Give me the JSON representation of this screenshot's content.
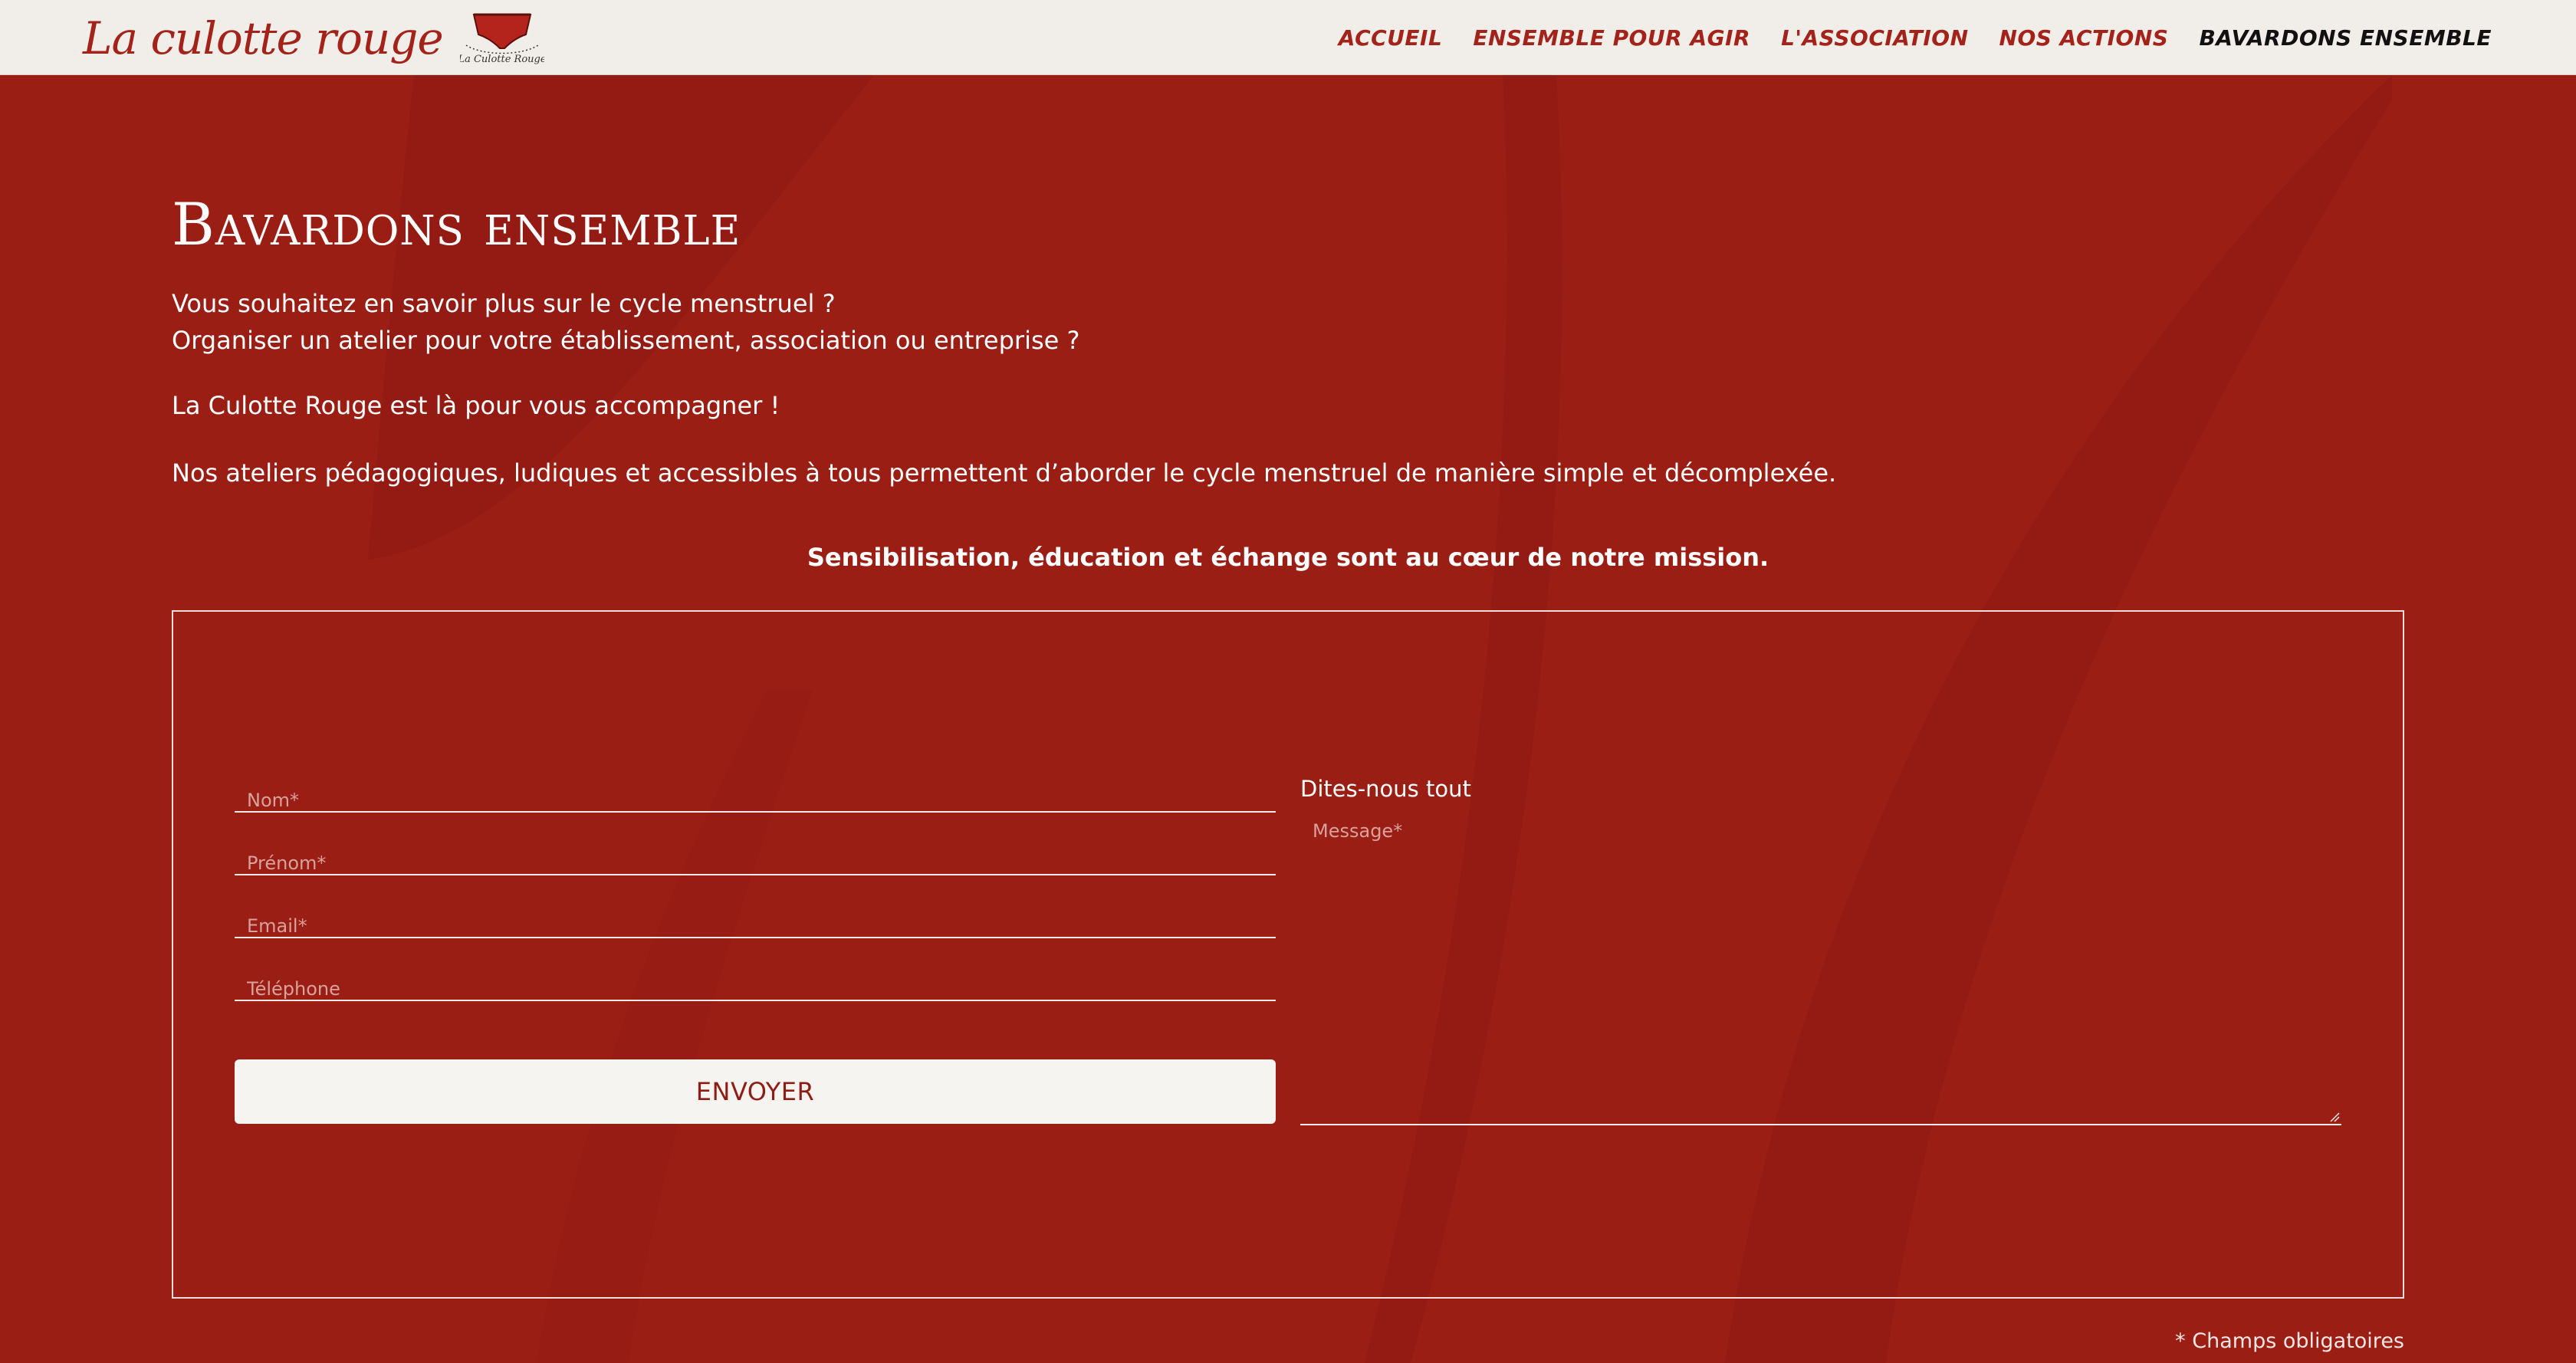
{
  "colors": {
    "background": "#9b1e15",
    "header_bg": "#f1eee9",
    "brand_red": "#a3231a",
    "nav_active": "#111111",
    "button_bg": "#f6f4f1"
  },
  "header": {
    "logo_text": "La culotte rouge",
    "logo_badge_text": "La Culotte Rouge",
    "nav": [
      {
        "label": "Accueil"
      },
      {
        "label": "Ensemble pour agir"
      },
      {
        "label": "L'association"
      },
      {
        "label": "Nos actions"
      },
      {
        "label": "Bavardons ensemble",
        "active": true
      }
    ]
  },
  "main": {
    "title": "Bavardons ensemble",
    "intro_line1": "Vous souhaitez en savoir plus sur le cycle menstruel ?",
    "intro_line2": "Organiser un atelier pour votre établissement, association ou entreprise ?",
    "paragraph2": "La Culotte Rouge est là pour vous accompagner !",
    "paragraph3": "Nos ateliers pédagogiques, ludiques et accessibles à tous permettent d’aborder le cycle menstruel de manière simple et décomplexée.",
    "mission": "Sensibilisation, éducation et échange sont au cœur de notre mission."
  },
  "form": {
    "nom_placeholder": "Nom*",
    "prenom_placeholder": "Prénom*",
    "email_placeholder": "Email*",
    "telephone_placeholder": "Téléphone",
    "message_label": "Dites-nous tout",
    "message_placeholder": "Message*",
    "submit_label": "Envoyer",
    "required_note": "* Champs obligatoires"
  }
}
